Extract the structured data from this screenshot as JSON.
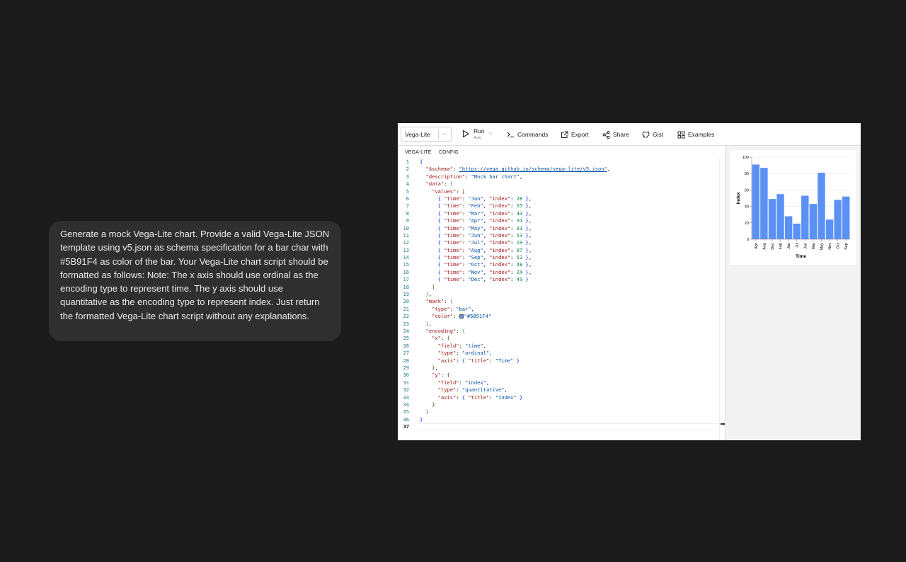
{
  "chat": {
    "prompt": "Generate a mock Vega-Lite chart. Provide a valid Vega-Lite JSON template using v5.json as schema specification for a bar char with #5B91F4 as color of the bar. Your Vega-Lite chart script should be formatted as follows: Note: The x axis should use ordinal as the encoding type to represent time. The y axis should use quantitative as the encoding type to represent index. Just return the formatted Vega-Lite chart script without any explanations."
  },
  "toolbar": {
    "mode": "Vega-Lite",
    "run": "Run",
    "run_sub": "Auto",
    "commands": "Commands",
    "export": "Export",
    "share": "Share",
    "gist": "Gist",
    "examples": "Examples"
  },
  "tabs": {
    "spec": "VEGA-LITE",
    "config": "CONFIG"
  },
  "editor": {
    "current_line": 37,
    "lines": [
      "<span class=\"b\">{</span>",
      "  <span class=\"k\">\"$schema\"</span>: <span class=\"u\">\"https://vega.github.io/schema/vega-lite/v5.json\"</span>,",
      "  <span class=\"k\">\"description\"</span>: <span class=\"s\">\"Mock bar chart\"</span>,",
      "  <span class=\"k\">\"data\"</span>: <span class=\"b2\">{</span>",
      "    <span class=\"k\">\"values\"</span>: <span class=\"b3\">[</span>",
      "      <span class=\"b\">{</span> <span class=\"k\">\"time\"</span>: <span class=\"s\">\"Jan\"</span>, <span class=\"k\">\"index\"</span>: <span class=\"n\">28</span> <span class=\"b\">}</span>,",
      "      <span class=\"b\">{</span> <span class=\"k\">\"time\"</span>: <span class=\"s\">\"Feb\"</span>, <span class=\"k\">\"index\"</span>: <span class=\"n\">55</span> <span class=\"b\">}</span>,",
      "      <span class=\"b\">{</span> <span class=\"k\">\"time\"</span>: <span class=\"s\">\"Mar\"</span>, <span class=\"k\">\"index\"</span>: <span class=\"n\">43</span> <span class=\"b\">}</span>,",
      "      <span class=\"b\">{</span> <span class=\"k\">\"time\"</span>: <span class=\"s\">\"Apr\"</span>, <span class=\"k\">\"index\"</span>: <span class=\"n\">91</span> <span class=\"b\">}</span>,",
      "      <span class=\"b\">{</span> <span class=\"k\">\"time\"</span>: <span class=\"s\">\"May\"</span>, <span class=\"k\">\"index\"</span>: <span class=\"n\">81</span> <span class=\"b\">}</span>,",
      "      <span class=\"b\">{</span> <span class=\"k\">\"time\"</span>: <span class=\"s\">\"Jun\"</span>, <span class=\"k\">\"index\"</span>: <span class=\"n\">53</span> <span class=\"b\">}</span>,",
      "      <span class=\"b\">{</span> <span class=\"k\">\"time\"</span>: <span class=\"s\">\"Jul\"</span>, <span class=\"k\">\"index\"</span>: <span class=\"n\">19</span> <span class=\"b\">}</span>,",
      "      <span class=\"b\">{</span> <span class=\"k\">\"time\"</span>: <span class=\"s\">\"Aug\"</span>, <span class=\"k\">\"index\"</span>: <span class=\"n\">87</span> <span class=\"b\">}</span>,",
      "      <span class=\"b\">{</span> <span class=\"k\">\"time\"</span>: <span class=\"s\">\"Sep\"</span>, <span class=\"k\">\"index\"</span>: <span class=\"n\">52</span> <span class=\"b\">}</span>,",
      "      <span class=\"b\">{</span> <span class=\"k\">\"time\"</span>: <span class=\"s\">\"Oct\"</span>, <span class=\"k\">\"index\"</span>: <span class=\"n\">48</span> <span class=\"b\">}</span>,",
      "      <span class=\"b\">{</span> <span class=\"k\">\"time\"</span>: <span class=\"s\">\"Nov\"</span>, <span class=\"k\">\"index\"</span>: <span class=\"n\">24</span> <span class=\"b\">}</span>,",
      "      <span class=\"b\">{</span> <span class=\"k\">\"time\"</span>: <span class=\"s\">\"Dec\"</span>, <span class=\"k\">\"index\"</span>: <span class=\"n\">49</span> <span class=\"b\">}</span>",
      "    <span class=\"b3\">]</span>",
      "  <span class=\"b2\">}</span>,",
      "  <span class=\"k\">\"mark\"</span>: <span class=\"b2\">{</span>",
      "    <span class=\"k\">\"type\"</span>: <span class=\"s\">\"bar\"</span>,",
      "    <span class=\"k\">\"color\"</span>: <span class=\"swatch\"></span><span class=\"s\">\"#5B91F4\"</span>",
      "  <span class=\"b2\">}</span>,",
      "  <span class=\"k\">\"encoding\"</span>: <span class=\"b2\">{</span>",
      "    <span class=\"k\">\"x\"</span>: <span class=\"b3\">{</span>",
      "      <span class=\"k\">\"field\"</span>: <span class=\"s\">\"time\"</span>,",
      "      <span class=\"k\">\"type\"</span>: <span class=\"s\">\"ordinal\"</span>,",
      "      <span class=\"k\">\"axis\"</span>: <span class=\"b\">{</span> <span class=\"k\">\"title\"</span>: <span class=\"s\">\"Time\"</span> <span class=\"b\">}</span>",
      "    <span class=\"b3\">}</span>,",
      "    <span class=\"k\">\"y\"</span>: <span class=\"b3\">{</span>",
      "      <span class=\"k\">\"field\"</span>: <span class=\"s\">\"index\"</span>,",
      "      <span class=\"k\">\"type\"</span>: <span class=\"s\">\"quantitative\"</span>,",
      "      <span class=\"k\">\"axis\"</span>: <span class=\"b\">{</span> <span class=\"k\">\"title\"</span>: <span class=\"s\">\"Index\"</span> <span class=\"b\">}</span>",
      "    <span class=\"b3\">}</span>",
      "  <span class=\"b2\">}</span>",
      "<span class=\"b\">}</span>",
      ""
    ]
  },
  "chart_data": {
    "type": "bar",
    "bar_color": "#5B91F4",
    "categories": [
      "Apr",
      "Aug",
      "Dec",
      "Feb",
      "Jan",
      "Jul",
      "Jun",
      "Mar",
      "May",
      "Nov",
      "Oct",
      "Sep"
    ],
    "values": [
      91,
      87,
      49,
      55,
      28,
      19,
      53,
      43,
      81,
      24,
      48,
      52
    ],
    "xlabel": "Time",
    "ylabel": "Index",
    "ylim": [
      0,
      100
    ],
    "yticks": [
      0,
      20,
      40,
      60,
      80,
      100
    ],
    "grid": true
  }
}
